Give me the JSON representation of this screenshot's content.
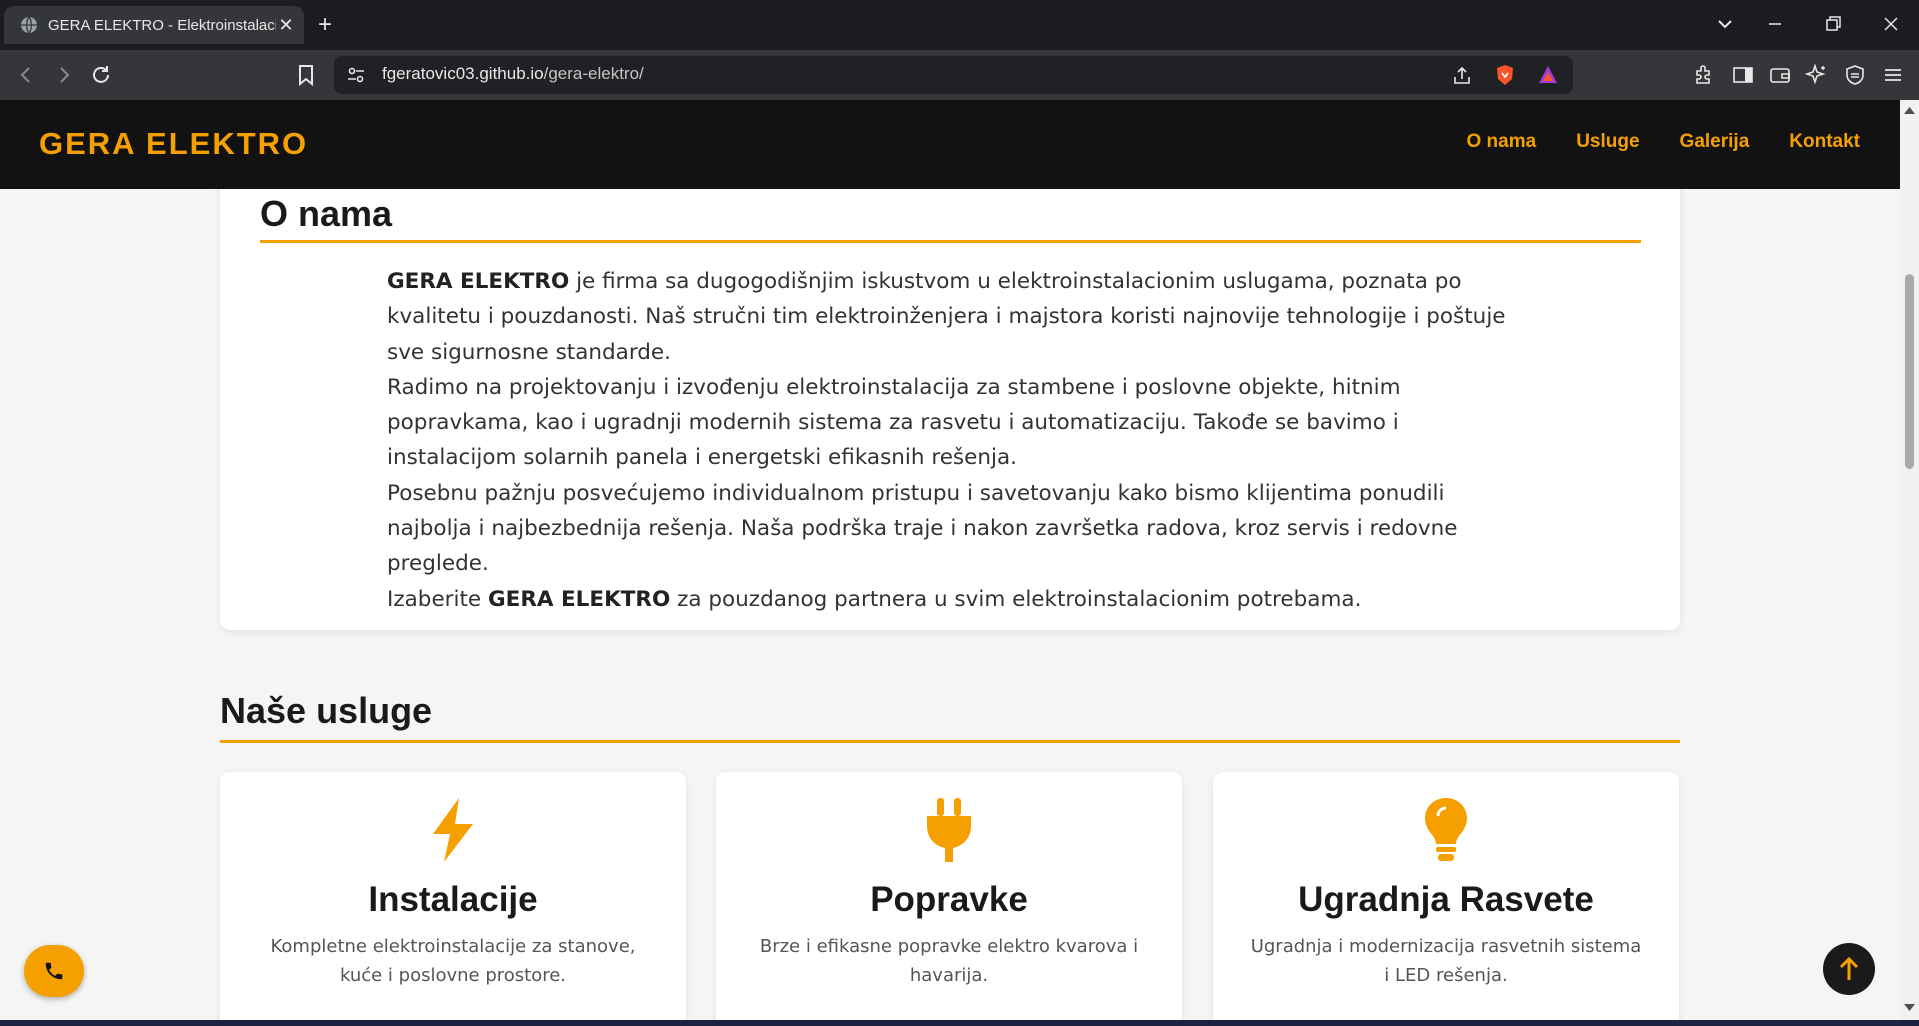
{
  "browser": {
    "tab_title": "GERA ELEKTRO - Elektroinstalacije",
    "url_domain": "fgeratovic03.github.io",
    "url_path": "/gera-elektro/"
  },
  "site": {
    "logo": "GERA ELEKTRO",
    "nav": [
      "O nama",
      "Usluge",
      "Galerija",
      "Kontakt"
    ],
    "accent_color": "#f5a000"
  },
  "about": {
    "title": "O nama",
    "p1_brand": "GERA ELEKTRO",
    "p1_rest": " je firma sa dugogodišnjim iskustvom u elektroinstalacionim uslugama, poznata po kvalitetu i pouzdanosti. Naš stručni tim elektroinženjera i majstora koristi najnovije tehnologije i poštuje sve sigurnosne standarde.",
    "p2": "Radimo na projektovanju i izvođenju elektroinstalacija za stambene i poslovne objekte, hitnim popravkama, kao i ugradnji modernih sistema za rasvetu i automatizaciju. Takođe se bavimo i instalacijom solarnih panela i energetski efikasnih rešenja.",
    "p3": "Posebnu pažnju posvećujemo individualnom pristupu i savetovanju kako bismo klijentima ponudili najbolja i najbezbednija rešenja. Naša podrška traje i nakon završetka radova, kroz servis i redovne preglede.",
    "p4_pre": "Izaberite ",
    "p4_brand": "GERA ELEKTRO",
    "p4_post": " za pouzdanog partnera u svim elektroinstalacionim potrebama."
  },
  "services": {
    "title": "Naše usluge",
    "items": [
      {
        "icon": "bolt-icon",
        "title": "Instalacije",
        "desc": "Kompletne elektroinstalacije za stanove, kuće i poslovne prostore."
      },
      {
        "icon": "plug-icon",
        "title": "Popravke",
        "desc": "Brze i efikasne popravke elektro kvarova i havarija."
      },
      {
        "icon": "lightbulb-icon",
        "title": "Ugradnja Rasvete",
        "desc": "Ugradnja i modernizacija rasvetnih sistema i LED rešenja."
      }
    ]
  },
  "floating": {
    "call_icon": "phone-icon",
    "top_icon": "arrow-up-icon"
  }
}
